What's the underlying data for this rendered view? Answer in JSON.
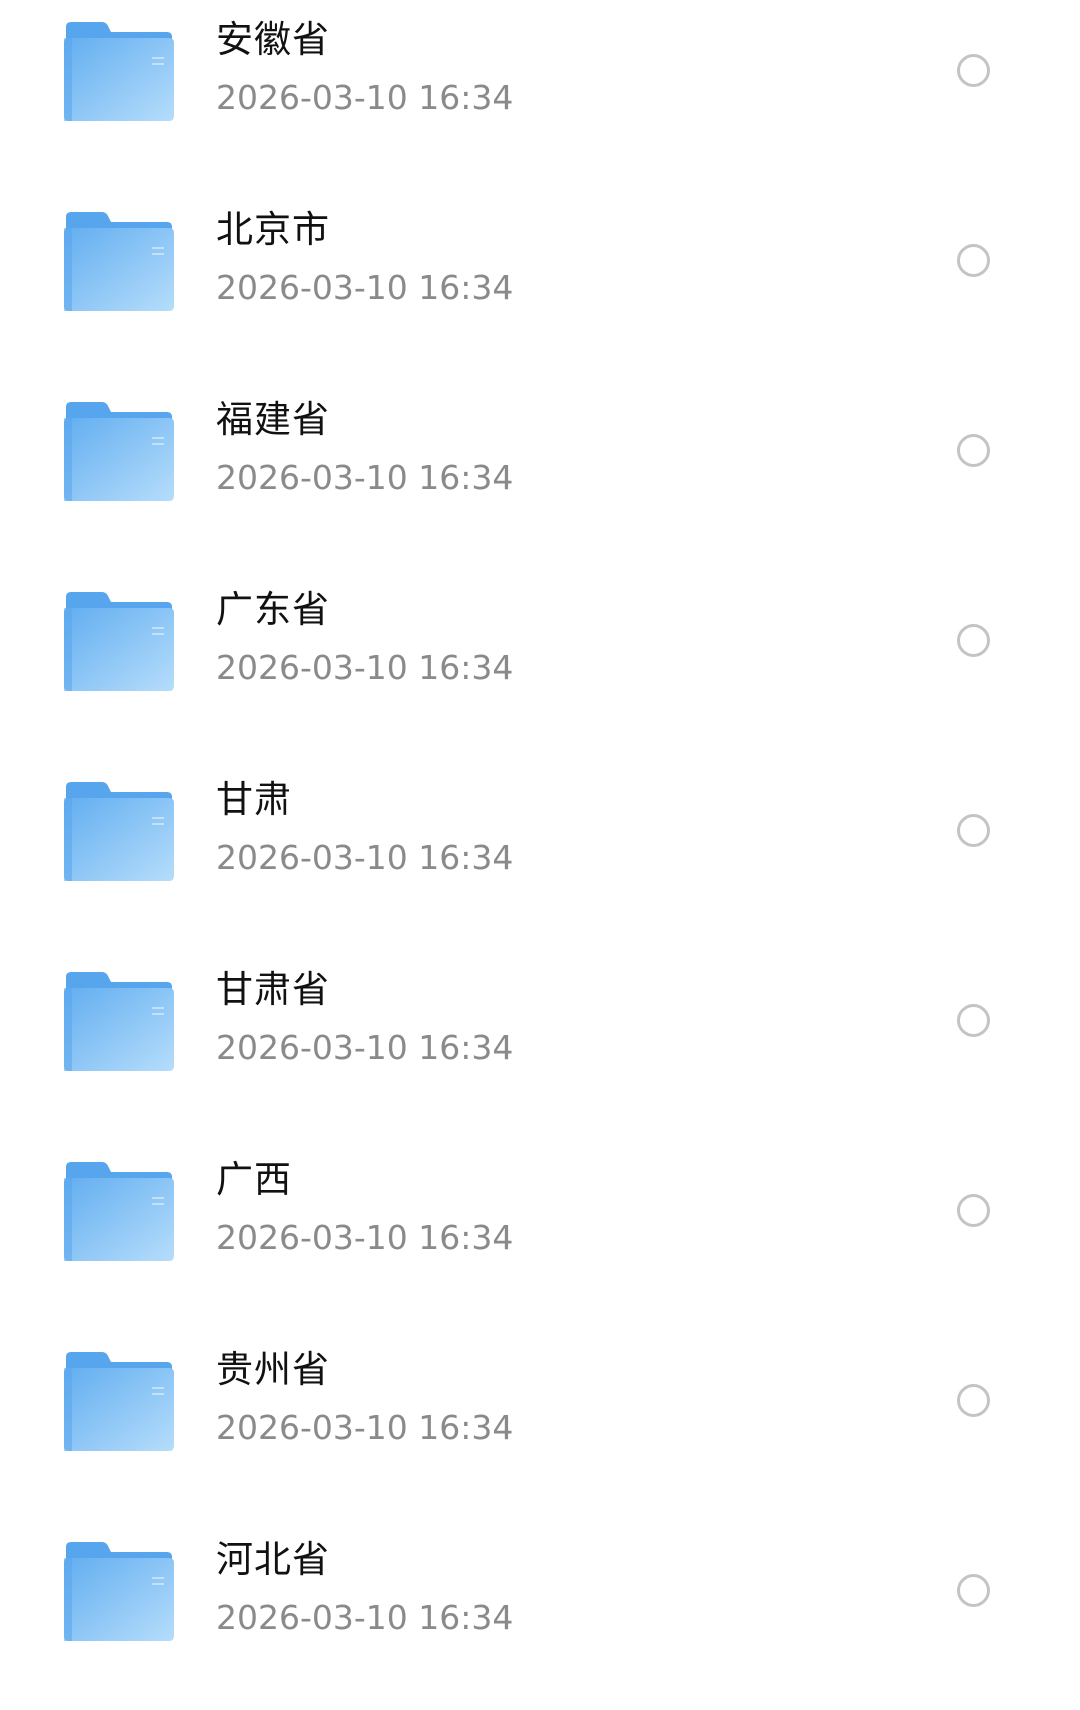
{
  "file_list": {
    "items": [
      {
        "name": "安徽省",
        "modified": "2026-03-10 16:34",
        "icon": "folder-icon",
        "selected": false
      },
      {
        "name": "北京市",
        "modified": "2026-03-10 16:34",
        "icon": "folder-icon",
        "selected": false
      },
      {
        "name": "福建省",
        "modified": "2026-03-10 16:34",
        "icon": "folder-icon",
        "selected": false
      },
      {
        "name": "广东省",
        "modified": "2026-03-10 16:34",
        "icon": "folder-icon",
        "selected": false
      },
      {
        "name": "甘肃",
        "modified": "2026-03-10 16:34",
        "icon": "folder-icon",
        "selected": false
      },
      {
        "name": "甘肃省",
        "modified": "2026-03-10 16:34",
        "icon": "folder-icon",
        "selected": false
      },
      {
        "name": "广西",
        "modified": "2026-03-10 16:34",
        "icon": "folder-icon",
        "selected": false
      },
      {
        "name": "贵州省",
        "modified": "2026-03-10 16:34",
        "icon": "folder-icon",
        "selected": false
      },
      {
        "name": "河北省",
        "modified": "2026-03-10 16:34",
        "icon": "folder-icon",
        "selected": false
      }
    ]
  },
  "colors": {
    "folder_top": "#6bb3f0",
    "folder_bottom": "#b4dcfb",
    "folder_tab": "#5aa7ec",
    "name_text": "#111111",
    "time_text": "#8a8a8a",
    "radio_border": "#c4c4c4"
  }
}
